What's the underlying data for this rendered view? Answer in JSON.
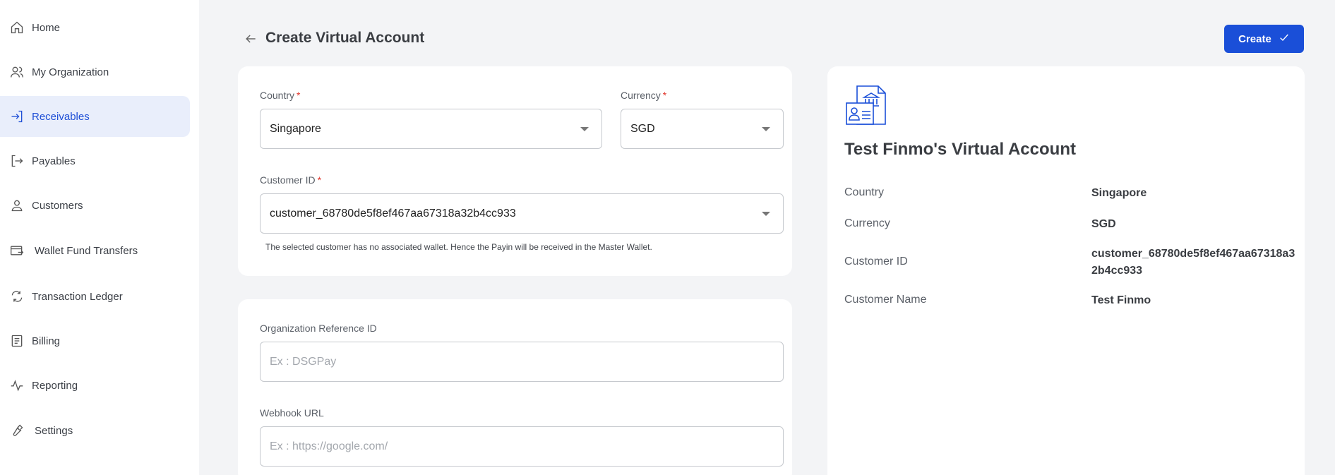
{
  "sidebar": {
    "items": [
      {
        "label": "Home",
        "icon": "home-icon"
      },
      {
        "label": "My Organization",
        "icon": "users-icon"
      },
      {
        "label": "Receivables",
        "icon": "sign-in-icon",
        "active": true
      },
      {
        "label": "Payables",
        "icon": "sign-out-icon"
      },
      {
        "label": "Customers",
        "icon": "user-icon"
      },
      {
        "label": "Wallet Fund Transfers",
        "icon": "wallet-transfer-icon"
      },
      {
        "label": "Transaction Ledger",
        "icon": "exchange-icon"
      },
      {
        "label": "Billing",
        "icon": "document-icon"
      },
      {
        "label": "Reporting",
        "icon": "activity-icon"
      },
      {
        "label": "Settings",
        "icon": "wrench-icon"
      }
    ]
  },
  "header": {
    "title": "Create Virtual Account",
    "create_label": "Create"
  },
  "form": {
    "country_label": "Country",
    "country_value": "Singapore",
    "currency_label": "Currency",
    "currency_value": "SGD",
    "customer_id_label": "Customer ID",
    "customer_id_value": "customer_68780de5f8ef467aa67318a32b4cc933",
    "customer_hint": "The selected customer has no associated wallet. Hence the Payin will be received in the Master Wallet.",
    "required_marker": "*",
    "org_ref_label": "Organization Reference ID",
    "org_ref_placeholder": "Ex : DSGPay",
    "webhook_label": "Webhook URL",
    "webhook_placeholder": "Ex : https://google.com/"
  },
  "summary": {
    "title": "Test Finmo's Virtual Account",
    "rows": [
      {
        "label": "Country",
        "value": "Singapore"
      },
      {
        "label": "Currency",
        "value": "SGD"
      },
      {
        "label": "Customer ID",
        "value": "customer_68780de5f8ef467aa67318a32b4cc933"
      },
      {
        "label": "Customer Name",
        "value": "Test Finmo"
      }
    ]
  },
  "colors": {
    "accent": "#1a4fd8",
    "active_nav_bg": "#e9eefb",
    "required": "#e0352b"
  }
}
